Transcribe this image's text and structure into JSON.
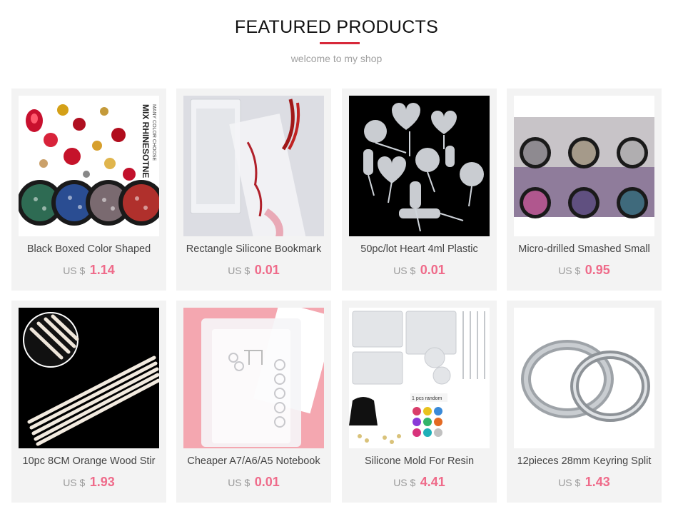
{
  "header": {
    "title": "FEATURED PRODUCTS",
    "subtitle": "welcome to my shop",
    "accent_color": "#d7283a"
  },
  "products": [
    {
      "name": "Black Boxed Color Shaped",
      "currency": "US $",
      "price": "1.14",
      "image_overlay": "MIX RHINESOTNE",
      "image_overlay2": "MANY COLOR CHOOSE"
    },
    {
      "name": "Rectangle Silicone Bookmark",
      "currency": "US $",
      "price": "0.01"
    },
    {
      "name": "50pc/lot Heart 4ml Plastic",
      "currency": "US $",
      "price": "0.01"
    },
    {
      "name": "Micro-drilled Smashed Small",
      "currency": "US $",
      "price": "0.95"
    },
    {
      "name": "10pc 8CM Orange Wood Stir",
      "currency": "US $",
      "price": "1.93"
    },
    {
      "name": "Cheaper A7/A6/A5 Notebook",
      "currency": "US $",
      "price": "0.01"
    },
    {
      "name": "Silicone Mold For Resin",
      "currency": "US $",
      "price": "4.41",
      "image_overlay": "1 pcs random"
    },
    {
      "name": "12pieces 28mm Keyring Split",
      "currency": "US $",
      "price": "1.43"
    }
  ],
  "price_color": "#ef6b8a",
  "card_bg": "#f3f3f3"
}
